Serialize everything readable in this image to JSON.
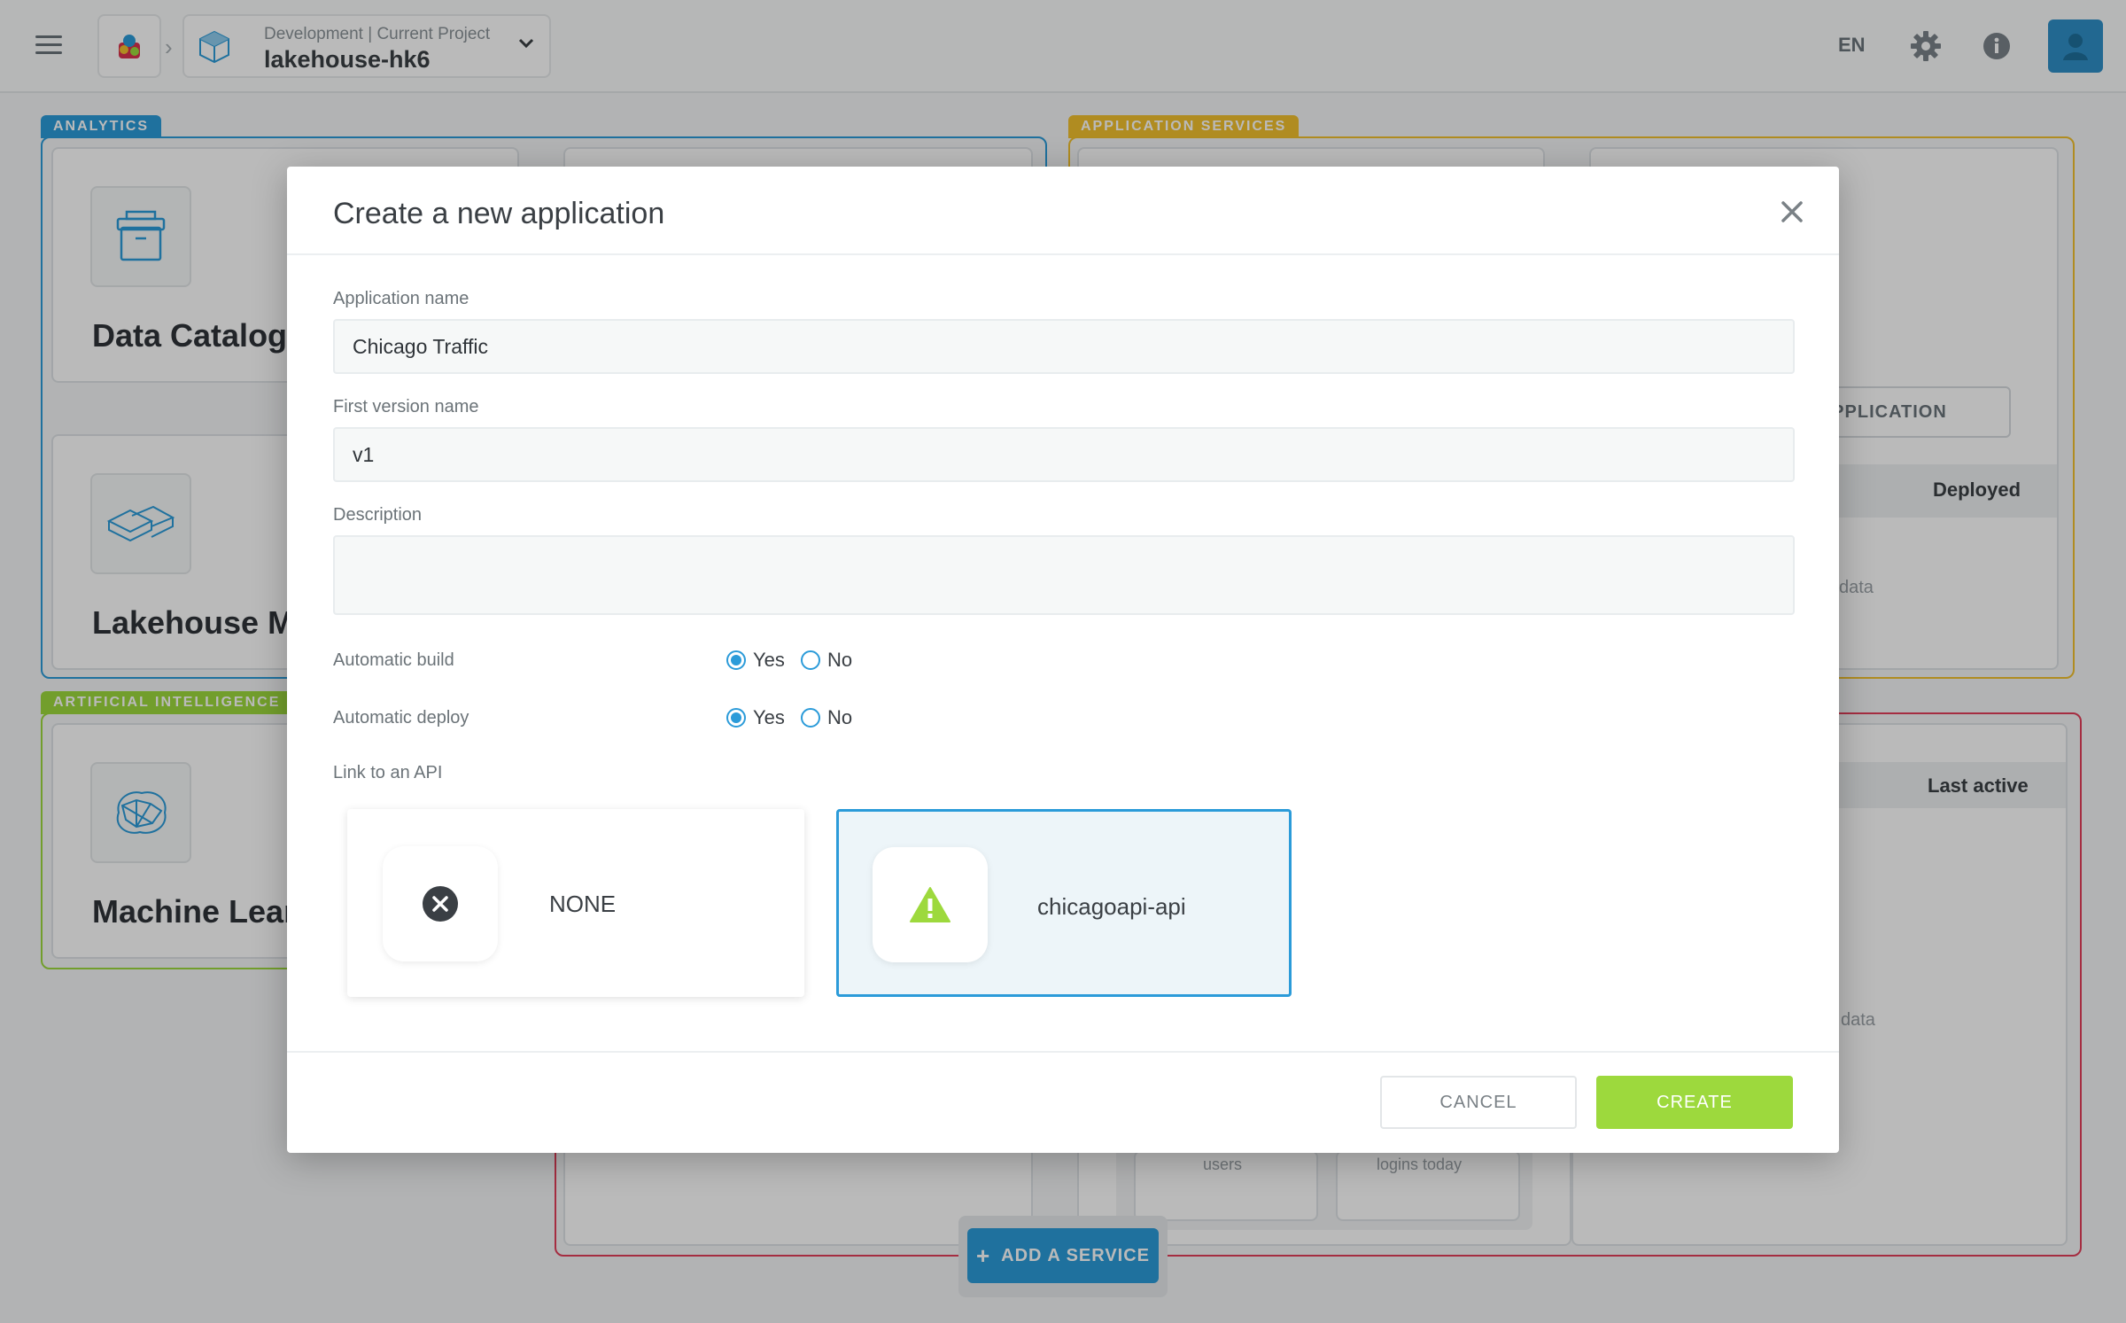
{
  "topbar": {
    "project_meta": "Development | Current Project",
    "project_name": "lakehouse-hk6",
    "language": "EN"
  },
  "dashboard": {
    "sections": {
      "analytics": "ANALYTICS",
      "application_services": "APPLICATION SERVICES",
      "artificial_intelligence": "ARTIFICIAL INTELLIGENCE"
    },
    "cards": {
      "data_catalog": "Data Catalog",
      "lakehouse": "Lakehouse Mar",
      "machine_learning": "Machine Learni"
    },
    "partial_texts": {
      "application_button": "PPLICATION",
      "deployed": "Deployed",
      "data_1": "data",
      "last_active": "Last active",
      "data_2": "data",
      "users": "users",
      "logins_today": "logins today"
    },
    "add_service": "ADD A SERVICE"
  },
  "modal": {
    "title": "Create a new application",
    "application_name": {
      "label": "Application name",
      "value": "Chicago Traffic"
    },
    "first_version": {
      "label": "First version name",
      "value": "v1"
    },
    "description": {
      "label": "Description",
      "value": ""
    },
    "automatic_build": {
      "label": "Automatic build",
      "yes": "Yes",
      "no": "No",
      "selected": "Yes"
    },
    "automatic_deploy": {
      "label": "Automatic deploy",
      "yes": "Yes",
      "no": "No",
      "selected": "Yes"
    },
    "link_api": {
      "label": "Link to an API",
      "options": [
        {
          "label": "NONE",
          "icon": "x-circle-icon",
          "selected": false
        },
        {
          "label": "chicagoapi-api",
          "icon": "warning-triangle-icon",
          "selected": true
        }
      ]
    },
    "cancel_label": "CANCEL",
    "create_label": "CREATE"
  },
  "colors": {
    "analytics": "#2b9bd9",
    "application_services": "#f2c12e",
    "artificial_intelligence": "#9dd93d",
    "red_section": "#e33e5a",
    "create_button": "#9dd93d",
    "selected_border": "#2b9bd9"
  }
}
